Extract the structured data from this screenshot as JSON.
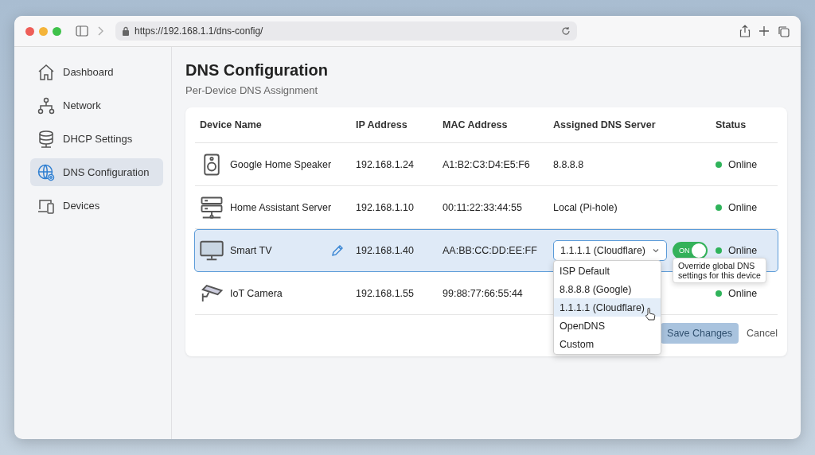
{
  "browser": {
    "url": "https://192.168.1.1/dns-config/"
  },
  "sidebar": {
    "items": [
      {
        "label": "Dashboard",
        "selected": false
      },
      {
        "label": "Network",
        "selected": false
      },
      {
        "label": "DHCP Settings",
        "selected": false
      },
      {
        "label": "DNS Configuration",
        "selected": true
      },
      {
        "label": "Devices",
        "selected": false
      }
    ]
  },
  "page": {
    "title": "DNS Configuration",
    "subtitle": "Per-Device DNS Assignment"
  },
  "table": {
    "columns": [
      "Device Name",
      "IP Address",
      "MAC Address",
      "Assigned DNS Server",
      "Status"
    ],
    "rows": [
      {
        "name": "Google Home Speaker",
        "ip": "192.168.1.24",
        "mac": "A1:B2:C3:D4:E5:F6",
        "dns": "8.8.8.8",
        "status": "Online",
        "selected": false
      },
      {
        "name": "Home Assistant Server",
        "ip": "192.168.1.10",
        "mac": "00:11:22:33:44:55",
        "dns": "Local (Pi-hole)",
        "status": "Online",
        "selected": false
      },
      {
        "name": "Smart TV",
        "ip": "192.168.1.40",
        "mac": "AA:BB:CC:DD:EE:FF",
        "dns": "1.1.1.1 (Cloudflare)",
        "status": "Online",
        "selected": true,
        "override": {
          "label": "ON",
          "on": true
        }
      },
      {
        "name": "IoT Camera",
        "ip": "192.168.1.55",
        "mac": "99:88:77:66:55:44",
        "status": "Online",
        "selected": false
      }
    ]
  },
  "dropdown": {
    "options": [
      {
        "label": "ISP Default",
        "selected": false
      },
      {
        "label": "8.8.8.8 (Google)",
        "selected": false
      },
      {
        "label": "1.1.1.1 (Cloudflare)",
        "selected": true
      },
      {
        "label": "OpenDNS",
        "selected": false
      },
      {
        "label": "Custom",
        "selected": false
      }
    ]
  },
  "tooltip": "Override global DNS settings for this device",
  "buttons": {
    "save": {
      "label": "Save Changes",
      "disabled": true
    },
    "cancel": "Cancel"
  }
}
